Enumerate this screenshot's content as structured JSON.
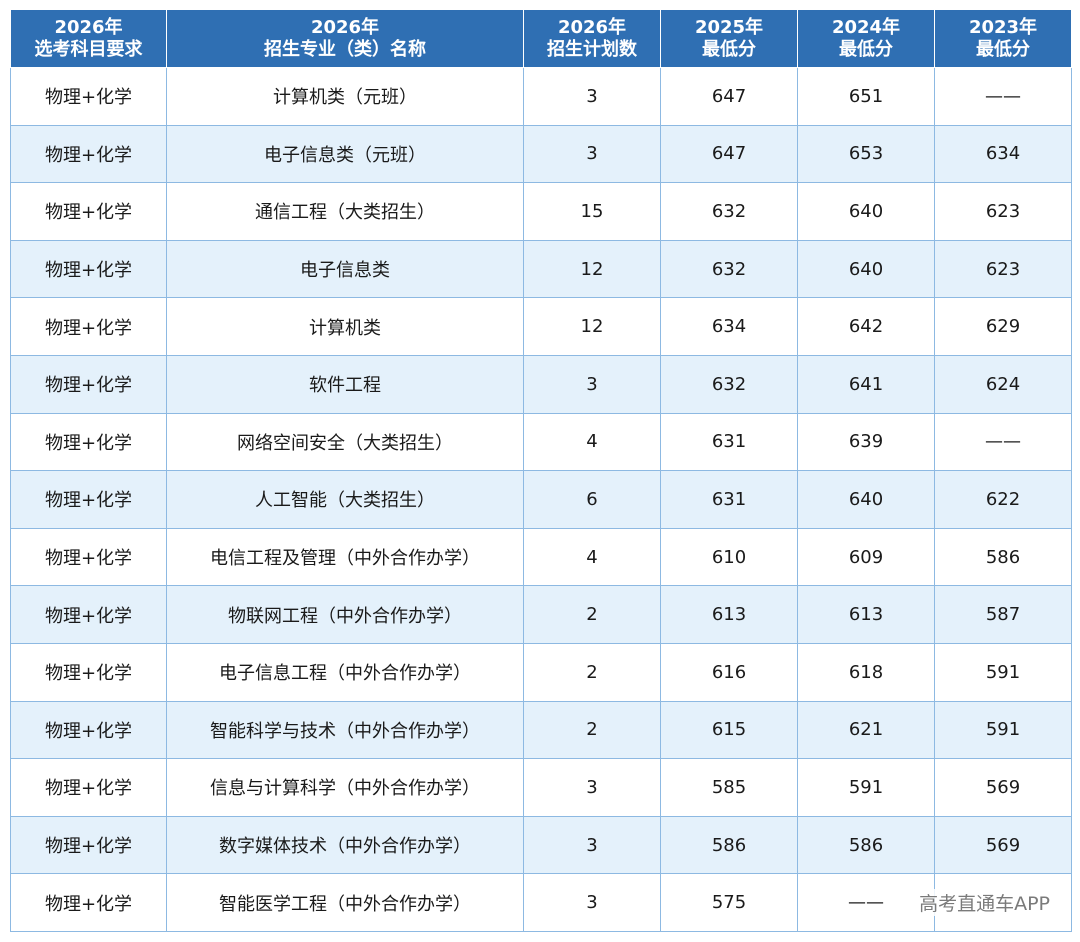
{
  "table": {
    "headers": [
      {
        "line1": "2026年",
        "line2": "选考科目要求"
      },
      {
        "line1": "2026年",
        "line2": "招生专业（类）名称"
      },
      {
        "line1": "2026年",
        "line2": "招生计划数"
      },
      {
        "line1": "2025年",
        "line2": "最低分"
      },
      {
        "line1": "2024年",
        "line2": "最低分"
      },
      {
        "line1": "2023年",
        "line2": "最低分"
      }
    ],
    "rows": [
      [
        "物理+化学",
        "计算机类（元班）",
        "3",
        "647",
        "651",
        "——"
      ],
      [
        "物理+化学",
        "电子信息类（元班）",
        "3",
        "647",
        "653",
        "634"
      ],
      [
        "物理+化学",
        "通信工程（大类招生）",
        "15",
        "632",
        "640",
        "623"
      ],
      [
        "物理+化学",
        "电子信息类",
        "12",
        "632",
        "640",
        "623"
      ],
      [
        "物理+化学",
        "计算机类",
        "12",
        "634",
        "642",
        "629"
      ],
      [
        "物理+化学",
        "软件工程",
        "3",
        "632",
        "641",
        "624"
      ],
      [
        "物理+化学",
        "网络空间安全（大类招生）",
        "4",
        "631",
        "639",
        "——"
      ],
      [
        "物理+化学",
        "人工智能（大类招生）",
        "6",
        "631",
        "640",
        "622"
      ],
      [
        "物理+化学",
        "电信工程及管理（中外合作办学）",
        "4",
        "610",
        "609",
        "586"
      ],
      [
        "物理+化学",
        "物联网工程（中外合作办学）",
        "2",
        "613",
        "613",
        "587"
      ],
      [
        "物理+化学",
        "电子信息工程（中外合作办学）",
        "2",
        "616",
        "618",
        "591"
      ],
      [
        "物理+化学",
        "智能科学与技术（中外合作办学）",
        "2",
        "615",
        "621",
        "591"
      ],
      [
        "物理+化学",
        "信息与计算科学（中外合作办学）",
        "3",
        "585",
        "591",
        "569"
      ],
      [
        "物理+化学",
        "数字媒体技术（中外合作办学）",
        "3",
        "586",
        "586",
        "569"
      ],
      [
        "物理+化学",
        "智能医学工程（中外合作办学）",
        "3",
        "575",
        "——",
        ""
      ]
    ]
  },
  "watermark": "高考直通车APP",
  "colors": {
    "header_bg": "#2f6fb3",
    "stripe_bg": "#e4f1fb",
    "border": "#8db9e2"
  }
}
